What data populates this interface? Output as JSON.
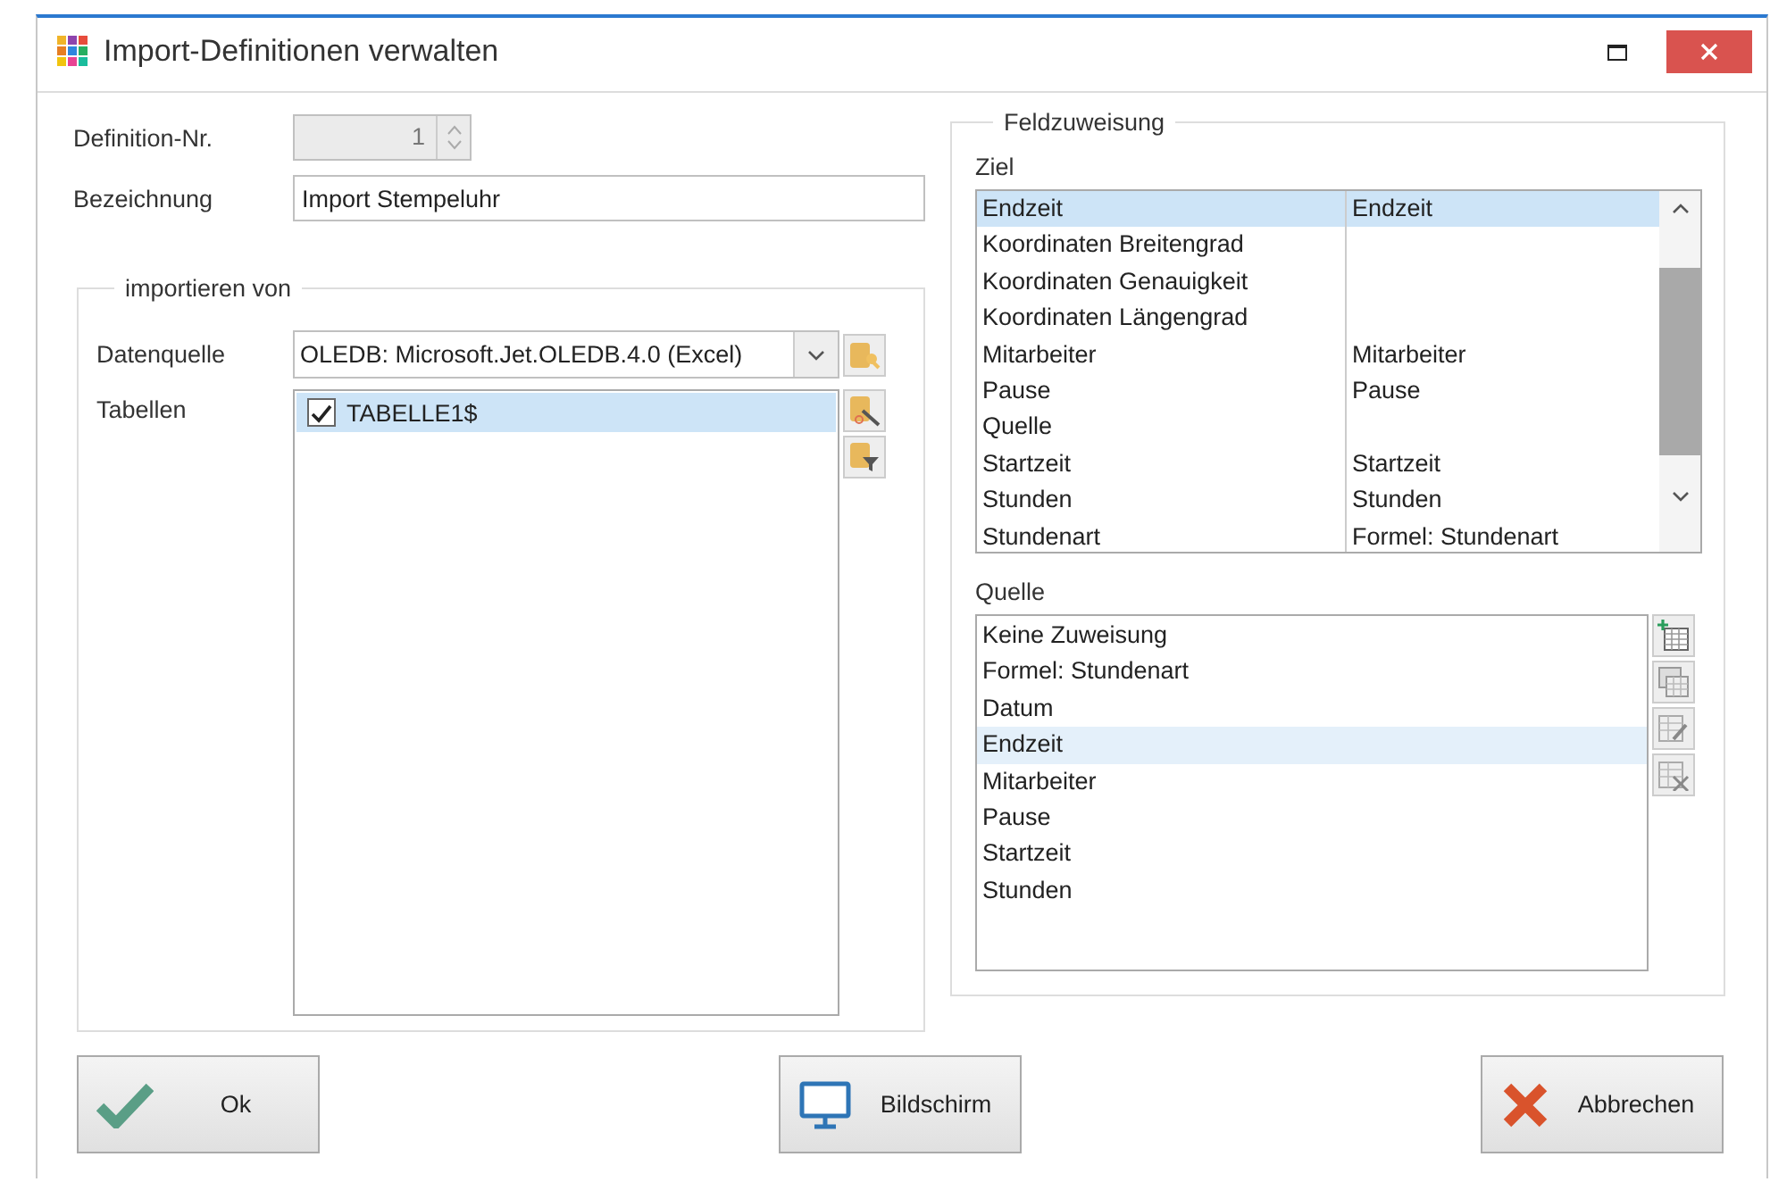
{
  "window": {
    "title": "Import-Definitionen verwalten"
  },
  "definition_nr": {
    "label": "Definition-Nr.",
    "value": "1",
    "disabled": true
  },
  "bezeichnung": {
    "label": "Bezeichnung",
    "value": "Import Stempeluhr"
  },
  "import_group": {
    "title": "importieren von",
    "datenquelle": {
      "label": "Datenquelle",
      "value": "OLEDB: Microsoft.Jet.OLEDB.4.0 (Excel)"
    },
    "tabellen": {
      "label": "Tabellen",
      "items": [
        {
          "label": "TABELLE1$",
          "checked": true,
          "selected": true
        }
      ]
    }
  },
  "feldzuweisung": {
    "title": "Feldzuweisung",
    "ziel": {
      "label": "Ziel",
      "rows": [
        {
          "target": "Endzeit",
          "source": "Endzeit",
          "selected": true
        },
        {
          "target": "Koordinaten Breitengrad",
          "selected": false
        },
        {
          "target": "Koordinaten Genauigkeit",
          "selected": false
        },
        {
          "target": "Koordinaten Längengrad",
          "selected": false
        },
        {
          "target": "Mitarbeiter",
          "source": "Mitarbeiter",
          "selected": false
        },
        {
          "target": "Pause",
          "source": "Pause",
          "selected": false
        },
        {
          "target": "Quelle",
          "selected": false
        },
        {
          "target": "Startzeit",
          "source": "Startzeit",
          "selected": false
        },
        {
          "target": "Stunden",
          "source": "Stunden",
          "selected": false
        },
        {
          "target": "Stundenart",
          "source": "Formel: Stundenart",
          "selected": false
        }
      ]
    },
    "quelle": {
      "label": "Quelle",
      "items": [
        {
          "label": "Keine Zuweisung",
          "selected": false
        },
        {
          "label": "Formel: Stundenart",
          "selected": false
        },
        {
          "label": "Datum",
          "selected": false
        },
        {
          "label": "Endzeit",
          "selected": true
        },
        {
          "label": "Mitarbeiter",
          "selected": false
        },
        {
          "label": "Pause",
          "selected": false
        },
        {
          "label": "Startzeit",
          "selected": false
        },
        {
          "label": "Stunden",
          "selected": false
        }
      ]
    }
  },
  "buttons": [
    {
      "label": "Ok",
      "kind": "ok"
    },
    {
      "label": "Bildschirm",
      "kind": "screen"
    },
    {
      "label": "Abbrechen",
      "kind": "cancel"
    }
  ]
}
